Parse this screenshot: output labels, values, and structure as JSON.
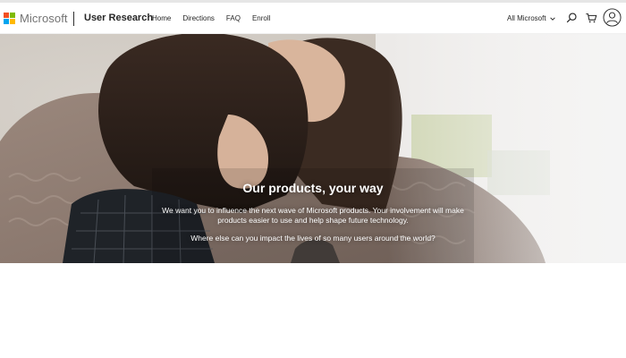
{
  "header": {
    "brand": "Microsoft",
    "site_title": "User Research",
    "nav": [
      "Home",
      "Directions",
      "FAQ",
      "Enroll"
    ],
    "all_microsoft": "All Microsoft",
    "icons": [
      "search-icon",
      "cart-icon",
      "account-icon",
      "chevron-down-icon"
    ]
  },
  "logo_colors": [
    "#f25022",
    "#7fba00",
    "#00a4ef",
    "#ffb900"
  ],
  "hero": {
    "heading": "Our products, your way",
    "paragraph1": "We want you to influence the next wave of Microsoft products. Your involvement will make products easier to use and help shape future technology.",
    "paragraph2": "Where else can you impact the lives of so many users around the world?"
  }
}
